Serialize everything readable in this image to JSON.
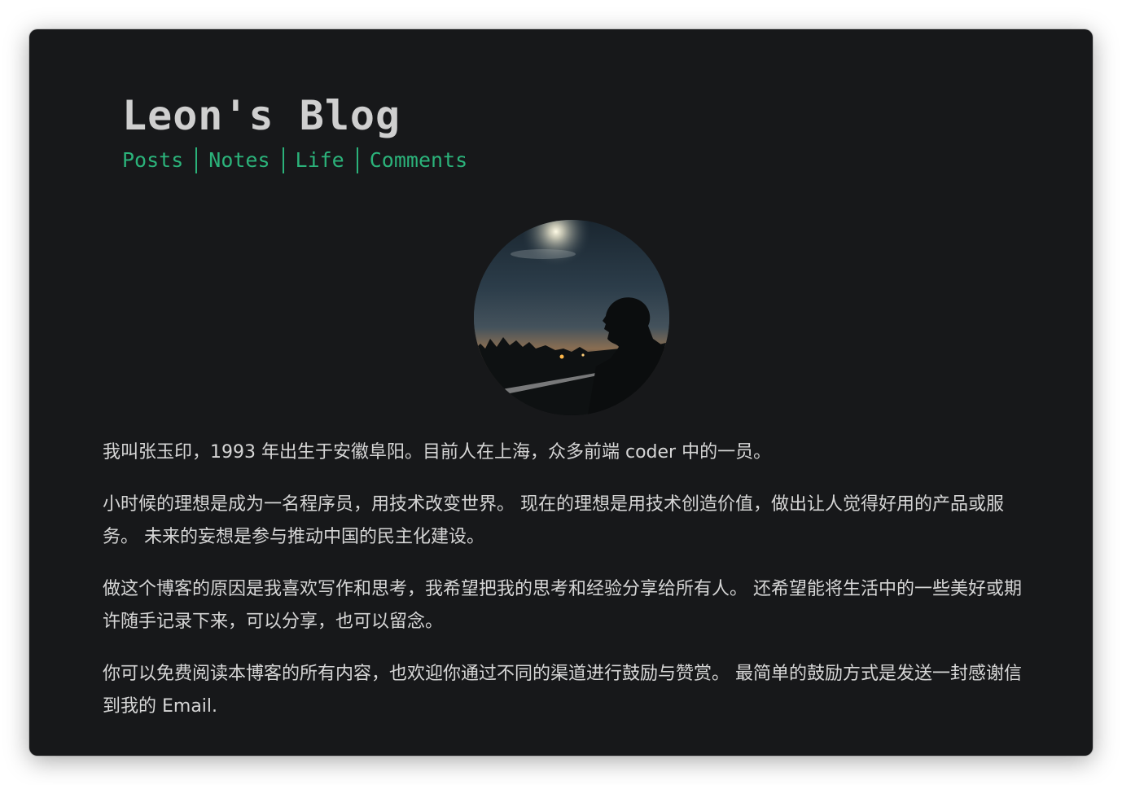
{
  "header": {
    "site_title": "Leon's Blog",
    "nav": [
      {
        "label": "Posts"
      },
      {
        "label": "Notes"
      },
      {
        "label": "Life"
      },
      {
        "label": "Comments"
      }
    ]
  },
  "colors": {
    "background": "#17181a",
    "title": "#cfcfcf",
    "accent": "#2bb27a",
    "text": "#d6d6d6"
  },
  "about": {
    "paragraphs": [
      "我叫张玉印，1993 年出生于安徽阜阳。目前人在上海，众多前端 coder 中的一员。",
      "小时候的理想是成为一名程序员，用技术改变世界。 现在的理想是用技术创造价值，做出让人觉得好用的产品或服务。 未来的妄想是参与推动中国的民主化建设。",
      "做这个博客的原因是我喜欢写作和思考，我希望把我的思考和经验分享给所有人。 还希望能将生活中的一些美好或期许随手记录下来，可以分享，也可以留念。",
      "你可以免费阅读本博客的所有内容，也欢迎你通过不同的渠道进行鼓励与赞赏。 最简单的鼓励方式是发送一封感谢信到我的 Email."
    ]
  }
}
